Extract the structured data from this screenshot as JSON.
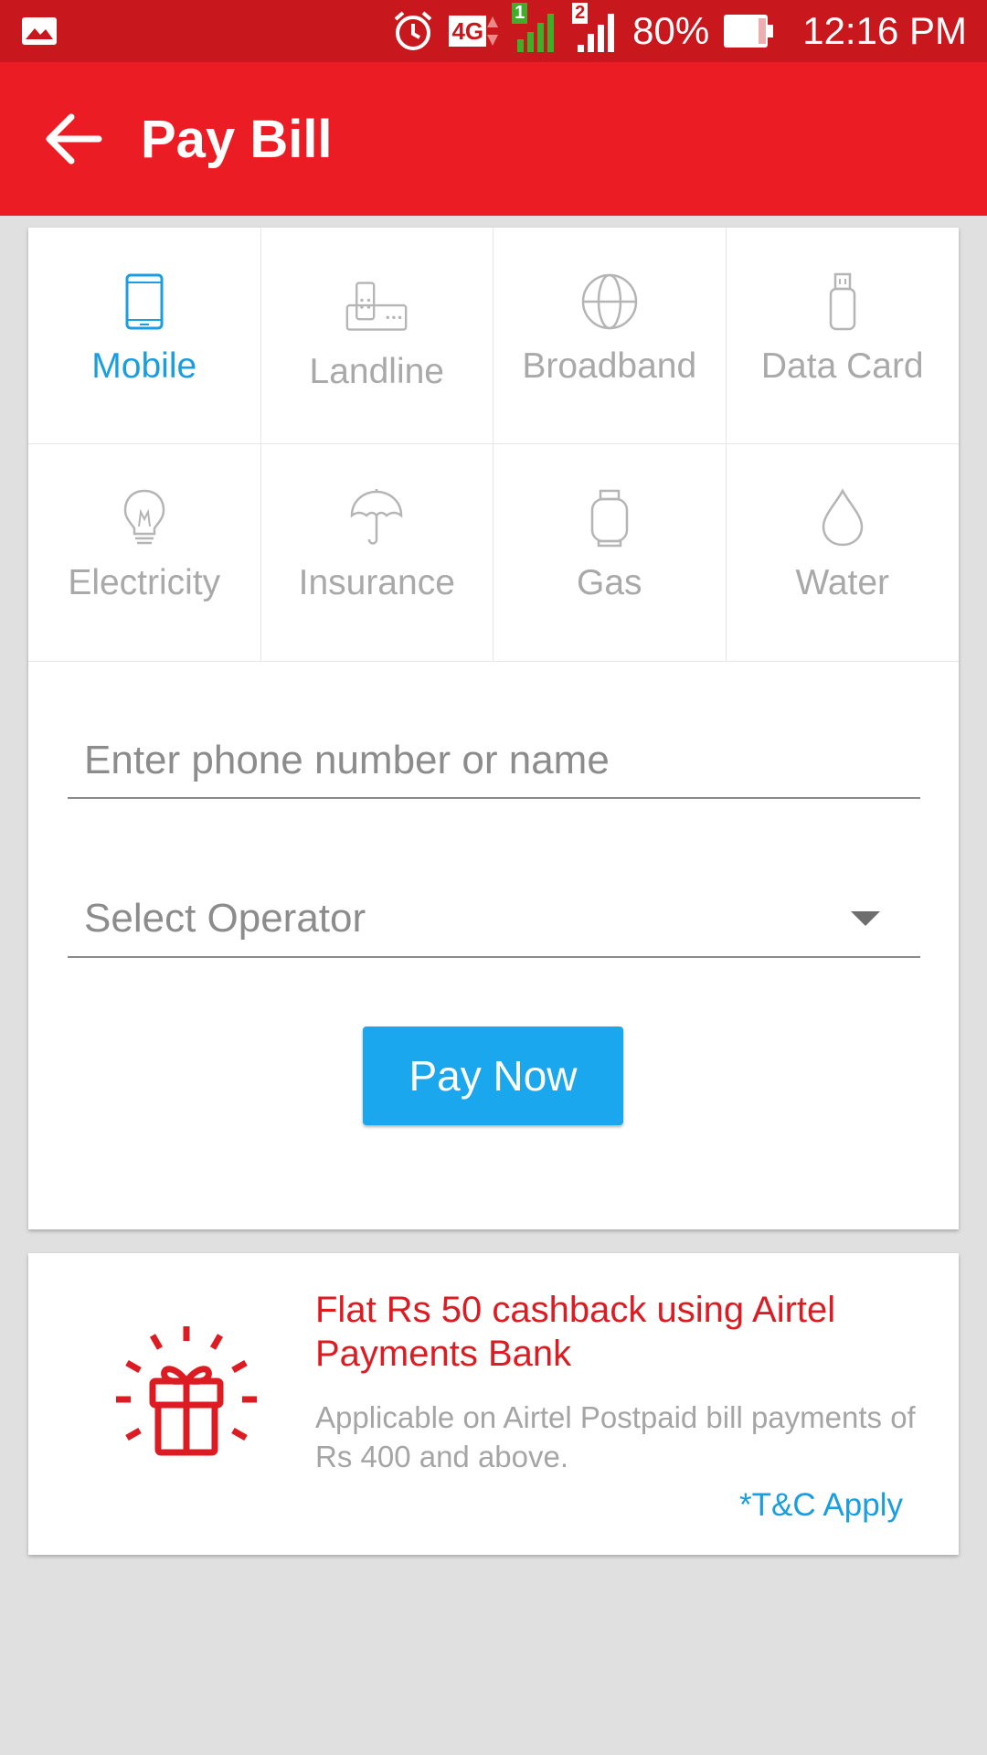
{
  "status_bar": {
    "network_type": "4G",
    "sim1_label": "1",
    "sim2_label": "2",
    "battery": "80%",
    "time": "12:16 PM"
  },
  "app_bar": {
    "title": "Pay Bill"
  },
  "categories": [
    {
      "label": "Mobile",
      "icon": "mobile-phone-icon",
      "active": true
    },
    {
      "label": "Landline",
      "icon": "landline-phone-icon",
      "active": false
    },
    {
      "label": "Broadband",
      "icon": "globe-icon",
      "active": false
    },
    {
      "label": "Data Card",
      "icon": "usb-dongle-icon",
      "active": false
    },
    {
      "label": "Electricity",
      "icon": "lightbulb-icon",
      "active": false
    },
    {
      "label": "Insurance",
      "icon": "umbrella-icon",
      "active": false
    },
    {
      "label": "Gas",
      "icon": "gas-cylinder-icon",
      "active": false
    },
    {
      "label": "Water",
      "icon": "water-drop-icon",
      "active": false
    }
  ],
  "form": {
    "phone_placeholder": "Enter phone number or name",
    "phone_value": "",
    "operator_label": "Select Operator",
    "pay_button": "Pay Now"
  },
  "offer": {
    "title": "Flat Rs 50 cashback using Airtel Payments Bank",
    "description": "Applicable on Airtel Postpaid bill payments of Rs 400 and above.",
    "tnc": "*T&C Apply",
    "icon": "gift-icon"
  },
  "colors": {
    "status_bar": "#c8181e",
    "app_bar": "#ec1c24",
    "accent_blue": "#1a9ee0",
    "button_blue": "#1aa7ee",
    "offer_red": "#dd1b22"
  }
}
